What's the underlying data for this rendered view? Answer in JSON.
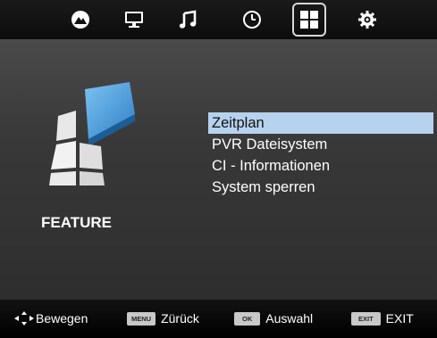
{
  "top_tabs": [
    {
      "icon": "picture-icon",
      "selected": false
    },
    {
      "icon": "monitor-icon",
      "selected": false
    },
    {
      "icon": "music-note-icon",
      "selected": false
    },
    {
      "icon": "clock-icon",
      "selected": false
    },
    {
      "icon": "feature-grid-icon",
      "selected": true
    },
    {
      "icon": "gear-icon",
      "selected": false
    }
  ],
  "feature": {
    "label": "FEATURE",
    "icon": "feature-blocks-icon"
  },
  "menu": {
    "items": [
      {
        "label": "Zeitplan",
        "selected": true
      },
      {
        "label": "PVR Dateisystem",
        "selected": false
      },
      {
        "label": "CI - Informationen",
        "selected": false
      },
      {
        "label": "System sperren",
        "selected": false
      }
    ]
  },
  "bottom_bar": {
    "move_label": "Bewegen",
    "back_key": "MENU",
    "back_label": "Zürück",
    "ok_key": "OK",
    "ok_label": "Auswahl",
    "exit_key": "EXIT",
    "exit_label": "EXIT"
  },
  "colors": {
    "highlight": "#b6d2ee",
    "accent_blue": "#4a9ee0",
    "background": "#3a3a3a"
  }
}
